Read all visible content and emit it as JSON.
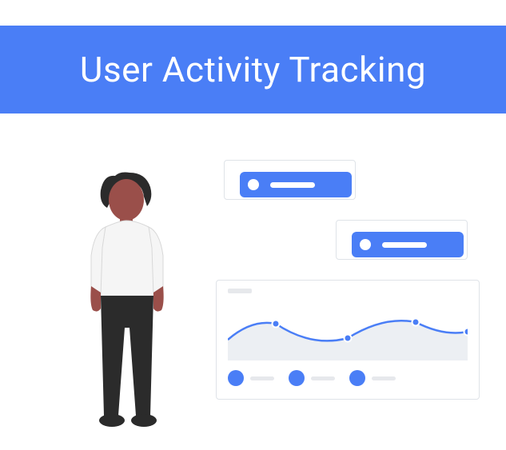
{
  "header": {
    "title": "User Activity Tracking"
  },
  "colors": {
    "accent": "#4a7ef6",
    "panel_border": "#dfe3e8",
    "muted": "#e6e8ec",
    "chart_fill": "#eceff3",
    "skin": "#9a4f4a",
    "hair": "#2b2b2b",
    "shirt": "#f5f5f5",
    "pants": "#2b2b2b"
  },
  "chart_data": {
    "type": "area",
    "x": [
      0,
      60,
      150,
      235,
      300
    ],
    "values": [
      50,
      30,
      48,
      28,
      40
    ],
    "ylim": [
      0,
      76
    ],
    "marker_points": [
      {
        "x": 60,
        "y": 30
      },
      {
        "x": 150,
        "y": 48
      },
      {
        "x": 235,
        "y": 28
      },
      {
        "x": 300,
        "y": 40
      }
    ],
    "legend_items": 3
  }
}
